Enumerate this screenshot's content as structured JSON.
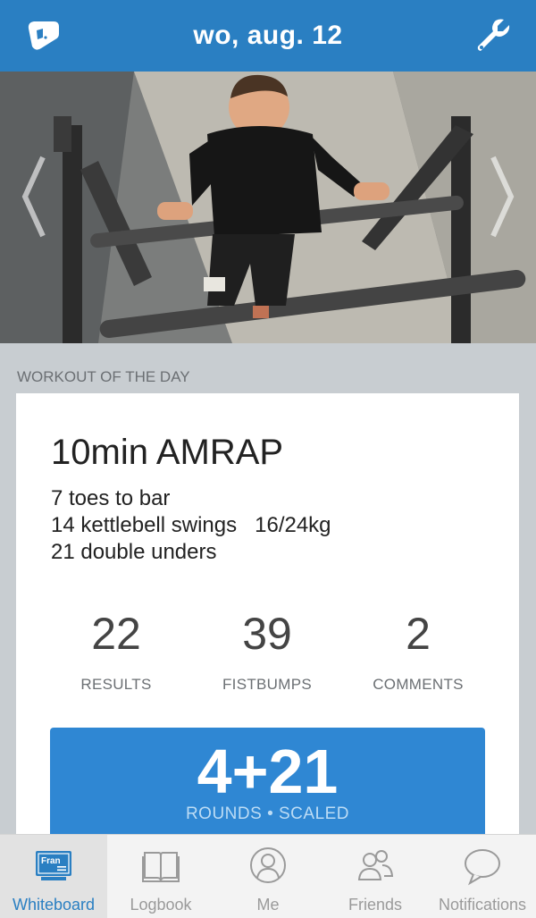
{
  "header": {
    "title": "wo, aug. 12",
    "left_icon": "whiteboard-logo-icon",
    "right_icon": "wrench-icon",
    "color": "#2a7fc2"
  },
  "hero": {
    "left_icon": "chevron-left-icon",
    "right_icon": "chevron-right-icon"
  },
  "section_label": "WORKOUT OF THE DAY",
  "workout": {
    "title": "10min AMRAP",
    "lines": [
      "7 toes to bar",
      "14 kettlebell swings   16/24kg",
      "21 double unders"
    ]
  },
  "stats": [
    {
      "value": "22",
      "label": "RESULTS"
    },
    {
      "value": "39",
      "label": "FISTBUMPS"
    },
    {
      "value": "2",
      "label": "COMMENTS"
    }
  ],
  "result": {
    "score": "4+21",
    "detail": "ROUNDS • SCALED",
    "color": "#2f87d3"
  },
  "tabbar": {
    "active_color": "#2a7fc2",
    "tabs": [
      {
        "label": "Whiteboard",
        "icon": "whiteboard-icon",
        "badge": "Fran"
      },
      {
        "label": "Logbook",
        "icon": "book-icon"
      },
      {
        "label": "Me",
        "icon": "person-icon"
      },
      {
        "label": "Friends",
        "icon": "friends-icon"
      },
      {
        "label": "Notifications",
        "icon": "speech-bubble-icon"
      }
    ]
  }
}
